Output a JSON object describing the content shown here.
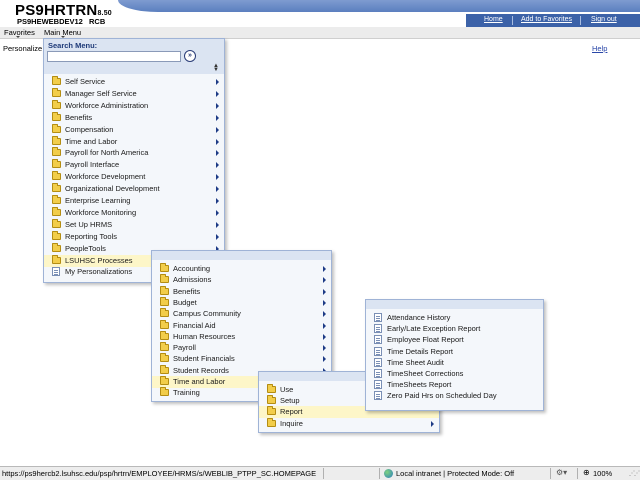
{
  "header": {
    "brand_main": "PS9HRTRN",
    "brand_version": "8.50",
    "server": "PS9HEWEBDEV12",
    "user": "RCB",
    "links": {
      "home": "Home",
      "add_favorites": "Add to Favorites",
      "sign_out": "Sign out"
    }
  },
  "menubar": {
    "favorites": "Favorites",
    "main_menu": "Main Menu"
  },
  "page": {
    "personalize": "Personalize",
    "help": "Help"
  },
  "main_menu": {
    "title": "Search Menu:",
    "search_value": "",
    "go": "»",
    "items": [
      "Self Service",
      "Manager Self Service",
      "Workforce Administration",
      "Benefits",
      "Compensation",
      "Time and Labor",
      "Payroll for North America",
      "Payroll Interface",
      "Workforce Development",
      "Organizational Development",
      "Enterprise Learning",
      "Workforce Monitoring",
      "Set Up HRMS",
      "Reporting Tools",
      "PeopleTools",
      "LSUHSC Processes",
      "My Personalizations"
    ]
  },
  "lsuhsc_menu": {
    "items": [
      "Accounting",
      "Admissions",
      "Benefits",
      "Budget",
      "Campus Community",
      "Financial Aid",
      "Human Resources",
      "Payroll",
      "Student Financials",
      "Student Records",
      "Time and Labor",
      "Training"
    ]
  },
  "time_labor_menu": {
    "items": [
      "Use",
      "Setup",
      "Report",
      "Inquire"
    ]
  },
  "report_menu": {
    "items": [
      "Attendance History",
      "Early/Late Exception Report",
      "Employee Float Report",
      "Time Details Report",
      "Time Sheet Audit",
      "TimeSheet Corrections",
      "TimeSheets Report",
      "Zero Paid Hrs on Scheduled Day"
    ]
  },
  "status": {
    "url": "https://ps9hercb2.lsuhsc.edu/psp/hrtrn/EMPLOYEE/HRMS/s/WEBLIB_PTPP_SC.HOMEPAGE",
    "zone": "Local intranet | Protected Mode: Off",
    "zoom": "100%"
  }
}
